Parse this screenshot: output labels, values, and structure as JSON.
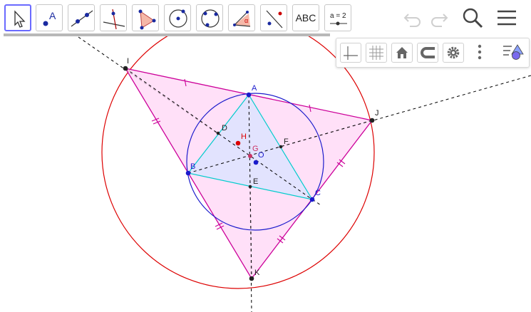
{
  "toolbar": {
    "tools": [
      {
        "name": "move-tool",
        "icon": "cursor-arrow-icon"
      },
      {
        "name": "point-tool",
        "icon": "point-icon",
        "label": "A"
      },
      {
        "name": "line-tool",
        "icon": "line-through-points-icon"
      },
      {
        "name": "perpendicular-line-tool",
        "icon": "perpendicular-line-icon"
      },
      {
        "name": "polygon-tool",
        "icon": "polygon-icon"
      },
      {
        "name": "circle-center-point-tool",
        "icon": "circle-center-icon"
      },
      {
        "name": "circle-three-points-tool",
        "icon": "circle-three-points-icon"
      },
      {
        "name": "angle-tool",
        "icon": "angle-icon",
        "label": "α"
      },
      {
        "name": "reflect-tool",
        "icon": "reflect-about-line-icon"
      },
      {
        "name": "text-tool",
        "icon": "text-icon",
        "label": "ABC"
      },
      {
        "name": "slider-tool",
        "icon": "slider-icon",
        "label": "a = 2"
      }
    ],
    "right": {
      "undo": "undo-icon",
      "redo": "redo-icon",
      "search": "search-icon",
      "menu": "menu-icon"
    }
  },
  "style_bar": {
    "buttons": [
      "axes-icon",
      "grid-icon",
      "home-icon",
      "point-capturing-icon",
      "gear-icon",
      "more-vertical-icon",
      "graphics-style-icon"
    ]
  },
  "colors": {
    "accent": "#6a6aff",
    "circumcircle": "#dd0000",
    "incircle": "#1a1acc",
    "outer_triangle": "#cc0099",
    "outer_fill": "#ffd6f5",
    "inner_triangle": "#00cccc",
    "inner_fill": "#dde3ff",
    "dashed_lines": "#000000"
  },
  "geometry": {
    "labels": {
      "A": "A",
      "B": "B",
      "C": "C",
      "D": "D",
      "E": "E",
      "F": "F",
      "G": "G",
      "H": "H",
      "O": "O",
      "I": "I",
      "J": "J",
      "K": "K"
    }
  }
}
